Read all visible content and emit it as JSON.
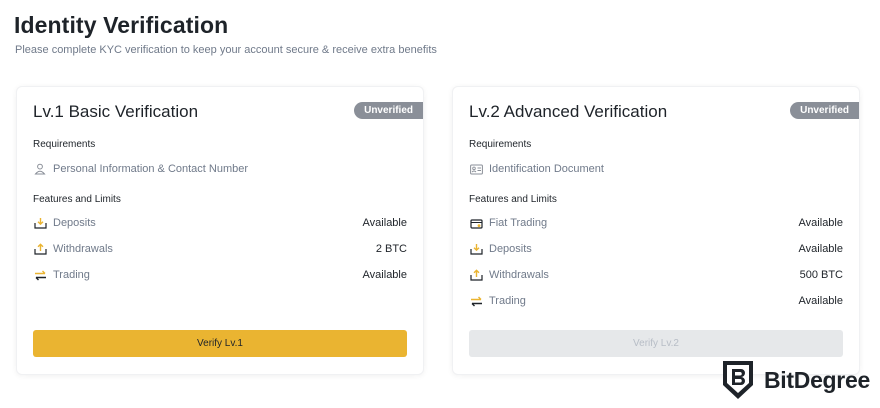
{
  "header": {
    "title": "Identity Verification",
    "subtitle": "Please complete KYC verification to keep your account secure & receive extra benefits"
  },
  "cards": [
    {
      "title": "Lv.1 Basic Verification",
      "status": "Unverified",
      "requirements_label": "Requirements",
      "requirement": "Personal Information & Contact Number",
      "features_label": "Features and Limits",
      "features": [
        {
          "label": "Deposits",
          "value": "Available",
          "icon": "deposit-icon"
        },
        {
          "label": "Withdrawals",
          "value": "2 BTC",
          "icon": "withdraw-icon"
        },
        {
          "label": "Trading",
          "value": "Available",
          "icon": "trade-icon"
        }
      ],
      "button": "Verify Lv.1"
    },
    {
      "title": "Lv.2 Advanced Verification",
      "status": "Unverified",
      "requirements_label": "Requirements",
      "requirement": "Identification Document",
      "features_label": "Features and Limits",
      "features": [
        {
          "label": "Fiat Trading",
          "value": "Available",
          "icon": "fiat-icon"
        },
        {
          "label": "Deposits",
          "value": "Available",
          "icon": "deposit-icon"
        },
        {
          "label": "Withdrawals",
          "value": "500 BTC",
          "icon": "withdraw-icon"
        },
        {
          "label": "Trading",
          "value": "Available",
          "icon": "trade-icon"
        }
      ],
      "button": "Verify Lv.2"
    }
  ],
  "brand": {
    "name": "BitDegree",
    "logo_letter": "B"
  },
  "colors": {
    "accent": "#eab431",
    "badge": "#8a8f98",
    "icon": "#eab431"
  }
}
